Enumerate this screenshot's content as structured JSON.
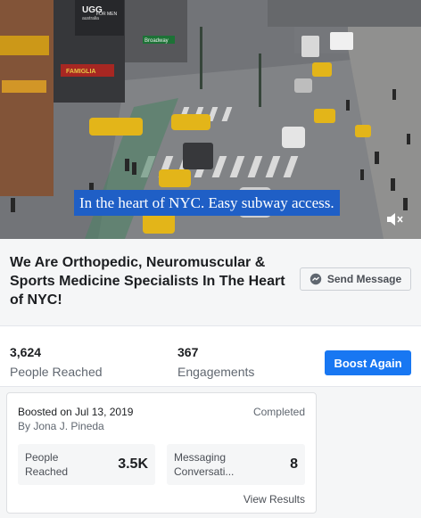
{
  "video": {
    "caption": "In the heart of NYC. Easy subway access.",
    "signs": {
      "ugg": "UGG",
      "ugg_sub": "australia",
      "for_men": "FOR MEN",
      "broadway": "Broadway",
      "famiglia": "FAMIGLIA"
    }
  },
  "post": {
    "title": "We Are Orthopedic, Neuromuscular & Sports Medicine Specialists In The Heart of NYC!",
    "send_message_label": "Send Message"
  },
  "stats": {
    "reached_value": "3,624",
    "reached_label": "People Reached",
    "engagements_value": "367",
    "engagements_label": "Engagements",
    "boost_again_label": "Boost Again"
  },
  "boost_card": {
    "boosted_on": "Boosted on Jul 13, 2019",
    "boosted_by": "By Jona J. Pineda",
    "status": "Completed",
    "metrics": [
      {
        "label_line1": "People",
        "label_line2": "Reached",
        "value": "3.5K"
      },
      {
        "label_line1": "Messaging",
        "label_line2": "Conversati...",
        "value": "8"
      }
    ],
    "view_results_label": "View Results"
  },
  "colors": {
    "accent": "#1877f2",
    "caption_bg": "#1f5fc6",
    "page_bg": "#f5f6f7"
  }
}
